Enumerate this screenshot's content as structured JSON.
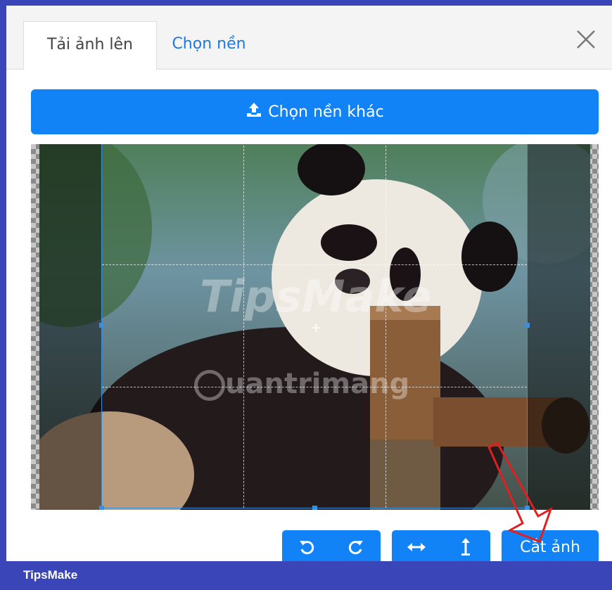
{
  "tabs": [
    {
      "label": "Tải ảnh lên",
      "active": true
    },
    {
      "label": "Chọn nền",
      "active": false
    }
  ],
  "upload_button": {
    "label": "Chọn nền khác",
    "icon": "upload-icon"
  },
  "image": {
    "description_icons": [
      "crop-grid",
      "crop-handles",
      "center-crosshair"
    ],
    "watermarks": [
      "TipsMake",
      "uantrimang"
    ]
  },
  "toolbar": {
    "rotate_left_icon": "rotate-left-icon",
    "rotate_right_icon": "rotate-right-icon",
    "flip_horizontal_icon": "flip-horizontal-icon",
    "flip_vertical_icon": "flip-vertical-icon",
    "crop_label": "Cắt ảnh"
  },
  "footer": {
    "brand": "TipsMake"
  },
  "colors": {
    "primary": "#1183f6",
    "footer": "#3a45b8",
    "crop_border": "#3b8fe0",
    "arrow": "#e02020"
  }
}
